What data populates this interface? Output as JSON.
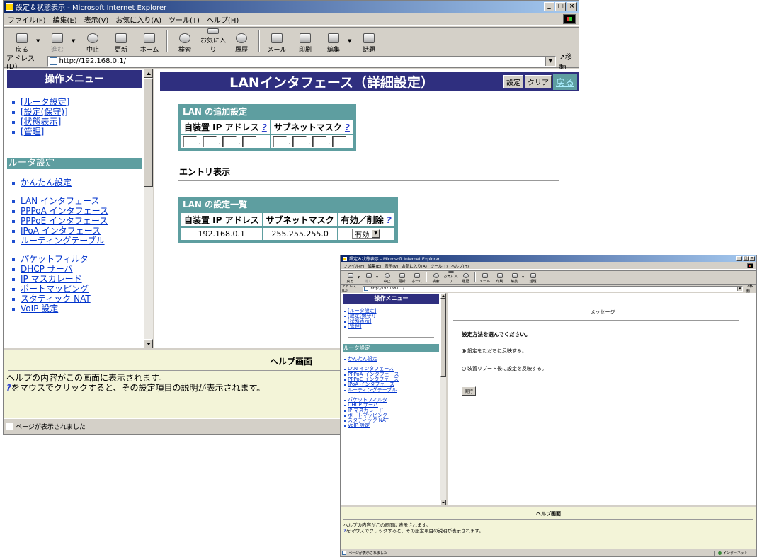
{
  "window_main": {
    "title": "設定＆状態表示 - Microsoft Internet Explorer",
    "menu": [
      "ファイル(F)",
      "編集(E)",
      "表示(V)",
      "お気に入り(A)",
      "ツール(T)",
      "ヘルプ(H)"
    ],
    "toolbar": {
      "back": "戻る",
      "forward": "進む",
      "stop": "中止",
      "refresh": "更新",
      "home": "ホーム",
      "search": "検索",
      "favorites": "お気に入り",
      "history": "履歴",
      "mail": "メール",
      "print": "印刷",
      "edit": "編集",
      "discuss": "話題"
    },
    "address": {
      "label": "アドレス(D)",
      "url": "http://192.168.0.1/",
      "go": "移動"
    },
    "menu_frame": {
      "title": "操作メニュー",
      "top_links": [
        "[ルータ設定]",
        "[設定(保守)]",
        "[状態表示]",
        "[管理]"
      ],
      "section": "ルータ設定",
      "group1": [
        "かんたん設定"
      ],
      "group2": [
        "LAN インタフェース",
        "PPPoA インタフェース",
        "PPPoE インタフェース",
        "IPoA インタフェース",
        "ルーティングテーブル"
      ],
      "group3": [
        "パケットフィルタ",
        "DHCP サーバ",
        "IP マスカレード",
        "ポートマッピング",
        "スタティック NAT",
        "VoIP 設定"
      ]
    },
    "main": {
      "title": "LANインタフェース（詳細設定）",
      "set_button": "設定",
      "clear_button": "クリア",
      "back_link": "戻る",
      "add_box": {
        "title": "LAN の追加設定",
        "col_ip": "自装置 IP アドレス",
        "col_mask": "サブネットマスク",
        "help": "?"
      },
      "entry_label": "エントリ表示",
      "list_box": {
        "title": "LAN の設定一覧",
        "col_ip": "自装置 IP アドレス",
        "col_mask": "サブネットマスク",
        "col_enable": "有効／削除",
        "help": "?",
        "row_ip": "192.168.0.1",
        "row_mask": "255.255.255.0",
        "row_enable": "有効"
      }
    },
    "help": {
      "title": "ヘルプ画面",
      "line1": "ヘルプの内容がこの画面に表示されます。",
      "line2": "をマウスでクリックすると、その設定項目の説明が表示されます。",
      "q": "?"
    },
    "status": "ページが表示されました"
  },
  "window_message": {
    "title": "設定＆状態表示 - Microsoft Internet Explorer",
    "menu": [
      "ファイル(F)",
      "編集(E)",
      "表示(V)",
      "お気に入り(A)",
      "ツール(T)",
      "ヘルプ(H)"
    ],
    "toolbar": {
      "back": "戻る",
      "forward": "進む",
      "stop": "中止",
      "refresh": "更新",
      "home": "ホーム",
      "search": "検索",
      "favorites": "お気に入り",
      "history": "履歴",
      "mail": "メール",
      "print": "印刷",
      "edit": "編集",
      "discuss": "話題"
    },
    "address": {
      "label": "アドレス(D)",
      "url": "http://192.168.0.1/",
      "go": "移動"
    },
    "menu_frame": {
      "title": "操作メニュー",
      "top_links": [
        "[ルータ設定]",
        "[設定(保守)]",
        "[状態表示]",
        "[管理]"
      ],
      "section": "ルータ設定",
      "group1": [
        "かんたん設定"
      ],
      "group2": [
        "LAN インタフェース",
        "PPPoA インタフェース",
        "PPPoE インタフェース",
        "IPoA インタフェース",
        "ルーティングテーブル"
      ],
      "group3": [
        "パケットフィルタ",
        "DHCP サーバ",
        "IP マスカレード",
        "ポートマッピング",
        "スタティック NAT",
        "VoIP 設定"
      ]
    },
    "main": {
      "title": "メッセージ",
      "prompt": "設定方法を選んでください。",
      "option1": "設定をただちに反映する。",
      "option2": "装置リブート後に設定を反映する。",
      "selected": "option1",
      "run_button": "実行"
    },
    "help": {
      "title": "ヘルプ画面",
      "line1": "ヘルプの内容がこの画面に表示されます。",
      "line2": "をマウスでクリックすると、その設定項目の説明が表示されます。",
      "q": "?"
    },
    "status": "ページが表示されました",
    "zone": "インターネット"
  }
}
